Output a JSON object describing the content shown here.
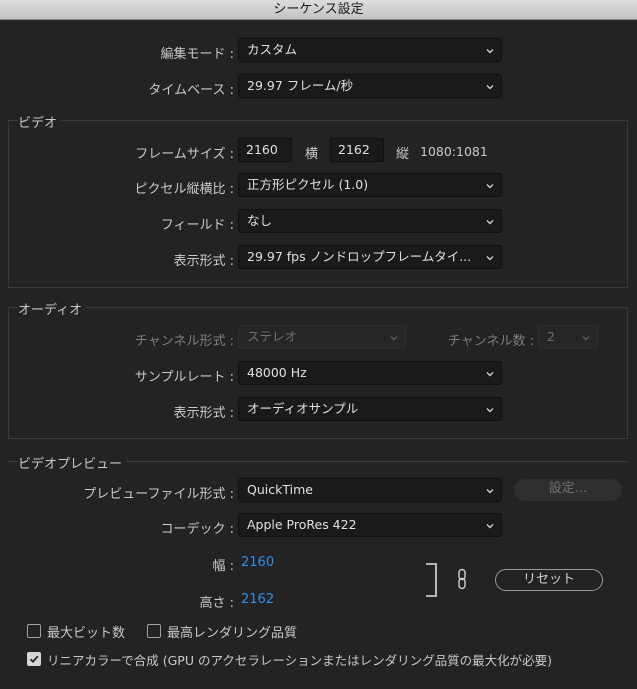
{
  "window": {
    "title": "シーケンス設定"
  },
  "general": {
    "edit_mode_label": "編集モード :",
    "edit_mode_value": "カスタム",
    "timebase_label": "タイムベース :",
    "timebase_value": "29.97  フレーム/秒"
  },
  "video": {
    "section_title": "ビデオ",
    "frame_size_label": "フレームサイズ :",
    "width_value": "2160",
    "width_unit": "横",
    "height_value": "2162",
    "height_unit": "縦",
    "aspect": "1080:1081",
    "pixel_aspect_label": "ピクセル縦横比 :",
    "pixel_aspect_value": "正方形ピクセル (1.0)",
    "fields_label": "フィールド :",
    "fields_value": "なし",
    "display_format_label": "表示形式 :",
    "display_format_value": "29.97 fps ノンドロップフレームタイ..."
  },
  "audio": {
    "section_title": "オーディオ",
    "channel_format_label": "チャンネル形式 :",
    "channel_format_value": "ステレオ",
    "channel_count_label": "チャンネル数 :",
    "channel_count_value": "2",
    "sample_rate_label": "サンプルレート :",
    "sample_rate_value": "48000 Hz",
    "display_format_label": "表示形式 :",
    "display_format_value": "オーディオサンプル"
  },
  "preview": {
    "section_title": "ビデオプレビュー",
    "file_format_label": "プレビューファイル形式 :",
    "file_format_value": "QuickTime",
    "settings_button": "設定...",
    "codec_label": "コーデック :",
    "codec_value": "Apple ProRes 422",
    "width_label": "幅 :",
    "width_value": "2160",
    "height_label": "高さ :",
    "height_value": "2162",
    "reset_button": "リセット"
  },
  "options": {
    "max_bit_depth": {
      "label": "最大ビット数",
      "checked": false
    },
    "max_render_quality": {
      "label": "最高レンダリング品質",
      "checked": false
    },
    "linear_color": {
      "label": "リニアカラーで合成 (GPU のアクセラレーションまたはレンダリング品質の最大化が必要)",
      "checked": true
    }
  }
}
